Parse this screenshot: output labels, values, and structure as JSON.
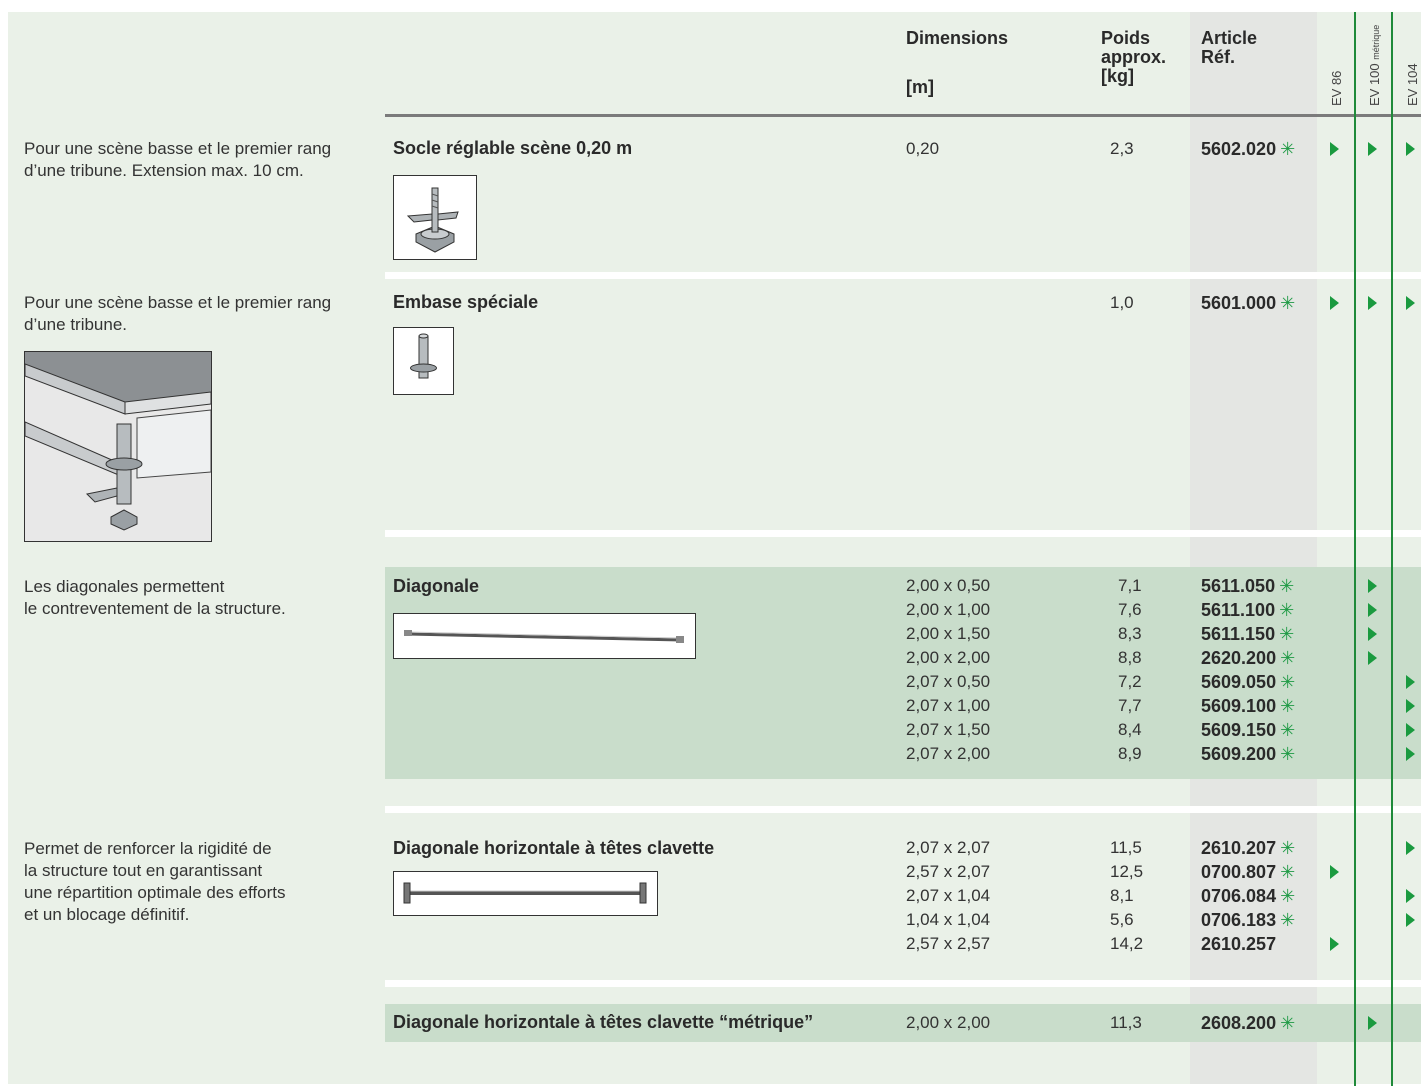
{
  "header": {
    "dimensions": "Dimensions",
    "dim_unit": "[m]",
    "weight": "Poids",
    "weight2": "approx.",
    "weight_unit": "[kg]",
    "article": "Article",
    "ref": "Réf.",
    "ev1": "EV 86",
    "ev2": "EV 100",
    "ev2_sub": "métrique",
    "ev3": "EV 104"
  },
  "colors": {
    "panel": "#eaf1e8",
    "highlight": "#c9ddcb",
    "accent_green": "#1a9a3f"
  },
  "rows": [
    {
      "description": "Pour une scène basse et le premier rang\nd’une tribune. Extension max. 10 cm.",
      "title": "Socle réglable scène 0,20 m",
      "dims": "0,20",
      "weights": "2,3",
      "refs": [
        "5602.020"
      ],
      "stars": [
        true
      ],
      "marks": {
        "ev86": [
          true
        ],
        "ev100": [
          true
        ],
        "ev104": [
          true
        ]
      }
    },
    {
      "description": "Pour une scène basse et le premier rang\nd’une tribune.",
      "title": "Embase spéciale",
      "dims": "",
      "weights": "1,0",
      "refs": [
        "5601.000"
      ],
      "stars": [
        true
      ],
      "marks": {
        "ev86": [
          true
        ],
        "ev100": [
          true
        ],
        "ev104": [
          true
        ]
      }
    },
    {
      "description": "Les diagonales permettent\nle contreventement de la structure.",
      "title": "Diagonale",
      "dims": "2,00 x 0,50\n2,00 x 1,00\n2,00 x 1,50\n2,00 x 2,00\n2,07 x 0,50\n2,07 x 1,00\n2,07 x 1,50\n2,07 x 2,00",
      "weights": "7,1\n7,6\n8,3\n8,8\n7,2\n7,7\n8,4\n8,9",
      "refs": [
        "5611.050",
        "5611.100",
        "5611.150",
        "2620.200",
        "5609.050",
        "5609.100",
        "5609.150",
        "5609.200"
      ],
      "stars": [
        true,
        true,
        true,
        true,
        true,
        true,
        true,
        true
      ],
      "marks": {
        "ev86": [
          false,
          false,
          false,
          false,
          false,
          false,
          false,
          false
        ],
        "ev100": [
          true,
          true,
          true,
          true,
          false,
          false,
          false,
          false
        ],
        "ev104": [
          false,
          false,
          false,
          false,
          true,
          true,
          true,
          true
        ]
      }
    },
    {
      "description": "Permet de renforcer la rigidité de\nla structure tout en garantissant\nune répartition optimale des efforts\net un blocage définitif.",
      "title": "Diagonale horizontale à têtes clavette",
      "dims": "2,07 x 2,07\n2,57 x 2,07\n2,07 x 1,04\n1,04 x 1,04\n2,57 x 2,57",
      "weights": "11,5\n12,5\n8,1\n5,6\n14,2",
      "refs": [
        "2610.207",
        "0700.807",
        "0706.084",
        "0706.183",
        "2610.257"
      ],
      "stars": [
        true,
        true,
        true,
        true,
        false
      ],
      "marks": {
        "ev86": [
          false,
          true,
          false,
          false,
          true
        ],
        "ev100": [
          false,
          false,
          false,
          false,
          false
        ],
        "ev104": [
          true,
          false,
          true,
          true,
          false
        ]
      }
    },
    {
      "description": "",
      "title": "Diagonale horizontale à têtes clavette “métrique”",
      "dims": "2,00 x 2,00",
      "weights": "11,3",
      "refs": [
        "2608.200"
      ],
      "stars": [
        true
      ],
      "marks": {
        "ev86": [
          false
        ],
        "ev100": [
          true
        ],
        "ev104": [
          false
        ]
      }
    }
  ],
  "star_glyph": "✳"
}
